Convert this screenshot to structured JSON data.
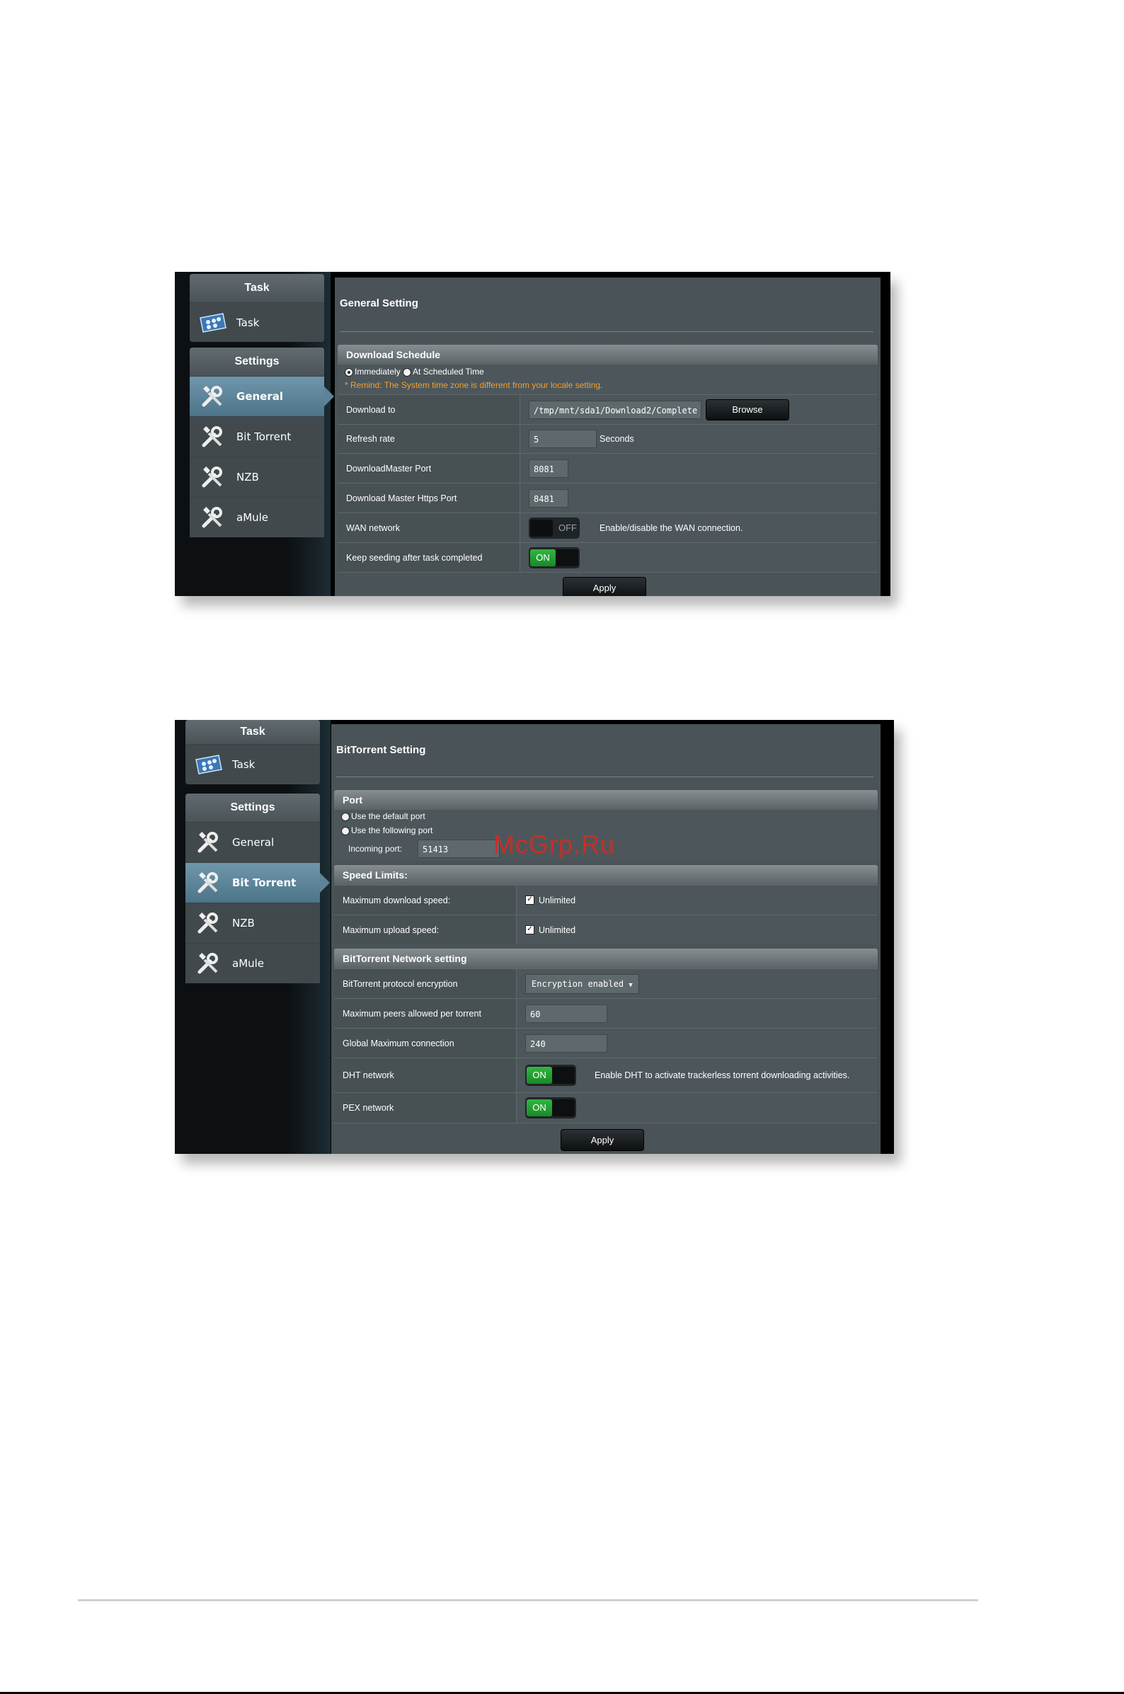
{
  "watermark": "McGrp.Ru",
  "shot1": {
    "sidebar": {
      "task_header": "Task",
      "task_item": "Task",
      "settings_header": "Settings",
      "items": [
        "General",
        "Bit Torrent",
        "NZB",
        "aMule"
      ],
      "active": "General"
    },
    "title": "General Setting",
    "section": "Download Schedule",
    "radio_immediately": "Immediately",
    "radio_scheduled": "At Scheduled Time",
    "remind": "* Remind: The System time zone is different from your locale setting.",
    "rows": {
      "download_to_label": "Download to",
      "download_to_value": "/tmp/mnt/sda1/Download2/Complete",
      "browse": "Browse",
      "refresh_label": "Refresh rate",
      "refresh_value": "5",
      "refresh_unit": "Seconds",
      "dm_port_label": "DownloadMaster Port",
      "dm_port_value": "8081",
      "dm_https_label": "Download Master Https Port",
      "dm_https_value": "8481",
      "wan_label": "WAN network",
      "wan_state": "OFF",
      "wan_desc": "Enable/disable the WAN connection.",
      "seed_label": "Keep seeding after task completed",
      "seed_state": "ON"
    },
    "apply": "Apply"
  },
  "shot2": {
    "sidebar": {
      "task_header": "Task",
      "task_item": "Task",
      "settings_header": "Settings",
      "items": [
        "General",
        "Bit Torrent",
        "NZB",
        "aMule"
      ],
      "active": "Bit Torrent"
    },
    "title": "BitTorrent Setting",
    "port_section": "Port",
    "radio_default": "Use the default port",
    "radio_following": "Use the following port",
    "incoming_label": "Incoming port:",
    "incoming_value": "51413",
    "speed_section": "Speed Limits:",
    "max_down_label": "Maximum download speed:",
    "max_down_value": "Unlimited",
    "max_up_label": "Maximum upload speed:",
    "max_up_value": "Unlimited",
    "network_section": "BitTorrent Network setting",
    "enc_label": "BitTorrent protocol encryption",
    "enc_value": "Encryption enabled",
    "peers_label": "Maximum peers allowed per torrent",
    "peers_value": "60",
    "global_label": "Global Maximum connection",
    "global_value": "240",
    "dht_label": "DHT network",
    "dht_state": "ON",
    "dht_desc": "Enable DHT to activate trackerless torrent downloading activities.",
    "pex_label": "PEX network",
    "pex_state": "ON",
    "apply": "Apply"
  },
  "icons": {
    "task": "task-icon",
    "settings": "wrench-screwdriver-icon"
  },
  "colors": {
    "toggle_on": "#22a034",
    "remind": "#f0a030",
    "active_item": "#5c8397"
  }
}
